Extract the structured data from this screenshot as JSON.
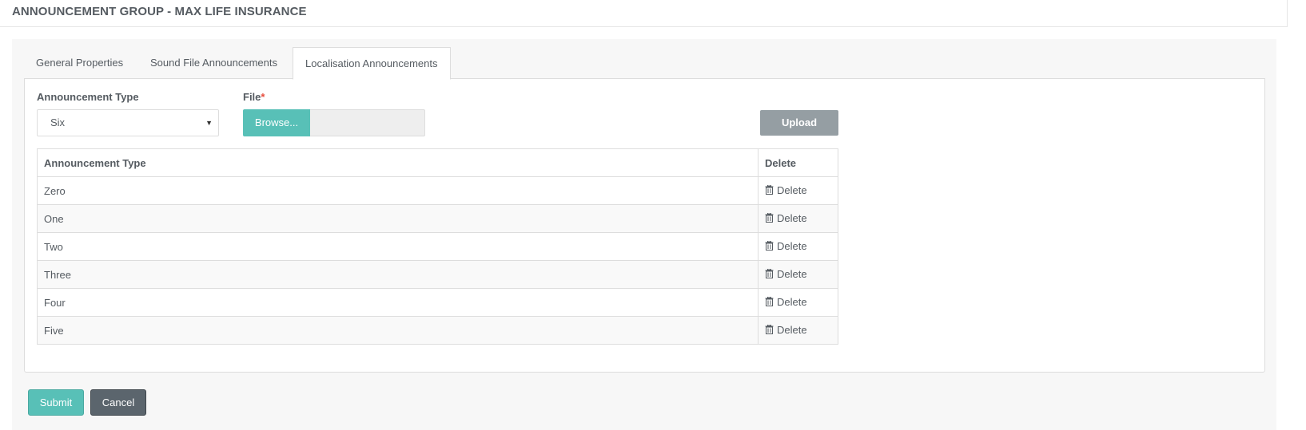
{
  "page": {
    "title": "ANNOUNCEMENT GROUP - MAX LIFE INSURANCE"
  },
  "tabs": [
    {
      "label": "General Properties",
      "active": false
    },
    {
      "label": "Sound File Announcements",
      "active": false
    },
    {
      "label": "Localisation Announcements",
      "active": true
    }
  ],
  "form": {
    "announcement_type_label": "Announcement Type",
    "announcement_type_value": "Six",
    "file_label": "File",
    "file_required_marker": "*",
    "browse_label": "Browse...",
    "upload_label": "Upload"
  },
  "table": {
    "headers": [
      "Announcement Type",
      "Delete"
    ],
    "delete_label": "Delete",
    "rows": [
      "Zero",
      "One",
      "Two",
      "Three",
      "Four",
      "Five"
    ]
  },
  "footer": {
    "submit_label": "Submit",
    "cancel_label": "Cancel"
  },
  "colors": {
    "accent": "#58c0b7",
    "upload": "#959ea3",
    "cancel": "#5b656d",
    "required": "#e74c3c"
  },
  "icons": {
    "delete": "trash-icon",
    "select": "caret-down-icon"
  }
}
